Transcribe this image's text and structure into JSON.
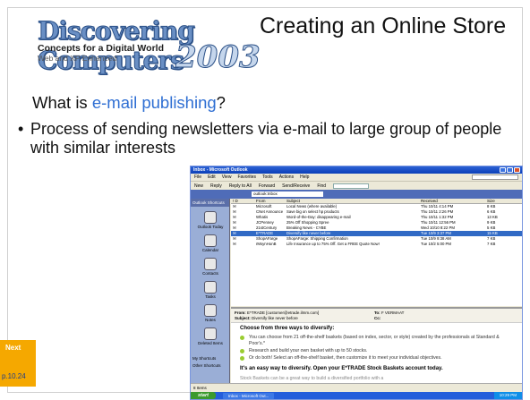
{
  "logo": {
    "brand": "Discovering Computers",
    "year": "2003",
    "tagline": "Concepts for a Digital World",
    "subtag": "Web and XP Enhanced"
  },
  "title": "Creating an Online Store",
  "question": {
    "prefix": "What is ",
    "link": "e-mail publishing",
    "suffix": "?"
  },
  "bullet": {
    "marker": "•",
    "text": "Process of sending newsletters via e-mail  to large group of people with similar interests"
  },
  "nav": {
    "next_label": "Next",
    "page_ref": "p.10.24"
  },
  "outlook": {
    "window_title": "Inbox - Microsoft Outlook",
    "menu": [
      "File",
      "Edit",
      "View",
      "Favorites",
      "Tools",
      "Actions",
      "Help"
    ],
    "toolbar": [
      "New",
      "Reply",
      "Reply to All",
      "Forward",
      "Send/Receive",
      "Find"
    ],
    "address": "outlook:Inbox",
    "sidebar": {
      "header": "Outlook Shortcuts",
      "items": [
        "Outlook Today",
        "Calendar",
        "Contacts",
        "Tasks",
        "Notes",
        "Deleted Items"
      ],
      "footer1": "My Shortcuts",
      "footer2": "Other Shortcuts"
    },
    "list_headers": [
      "! D",
      "From",
      "Subject",
      "Received",
      "Size"
    ],
    "rows": [
      {
        "from": "Microsoft",
        "subject": "Local News (where available)",
        "received": "Thu 10/11 4:14 PM",
        "size": "8 KB"
      },
      {
        "from": "CNet Announce",
        "subject": "Save big on select hp products",
        "received": "Thu 10/11 2:26 PM",
        "size": "6 KB"
      },
      {
        "from": "Whatis",
        "subject": "Word-of-the-Day: disappearing e-mail",
        "received": "Thu 10/11 1:32 PM",
        "size": "13 KB"
      },
      {
        "from": "JCPenney",
        "subject": "25% Off Shopping Spree",
        "received": "Thu 10/11 12:56 PM",
        "size": "9 KB"
      },
      {
        "from": "21stCentury",
        "subject": "Breaking News - CYBE",
        "received": "Wed 10/10 8:22 PM",
        "size": "5 KB"
      },
      {
        "from": "E*TRADE",
        "subject": "Diversify like never before",
        "received": "Tue 10/9 3:37 PM",
        "size": "15 KB",
        "selected": true
      },
      {
        "from": "ShopAFarge",
        "subject": "ShopAFarge: Shipping Confirmation",
        "received": "Tue 10/9 9:38 AM",
        "size": "7 KB"
      },
      {
        "from": "rMsynHonB",
        "subject": "Life Insurance up to 75% Off. Get a FREE Quote Now!",
        "received": "Tue 10/2 5:00 PM",
        "size": "7 KB"
      }
    ],
    "preview": {
      "from_label": "From:",
      "from_value": "E*TRADE [customer@etrade.ilmm.com]",
      "subject_label": "Subject:",
      "subject_value": "Diversify like never before",
      "to_label": "To:",
      "to_value": "F VERMAAT",
      "cc_label": "Cc:",
      "heading": "Choose from three ways to diversify:",
      "items": [
        "You can choose from 21 off-the-shelf baskets (based on index, sector, or style) created by the professionals at Standard & Poor's.*",
        "Research and build your own basket with up to 50 stocks.",
        "Or do both! Select an off-the-shelf basket, then customize it to meet your individual objectives."
      ],
      "tagline": "It's an easy way to diversify. Open your E*TRADE Stock Baskets account today.",
      "tail": "Stock Baskets can be a great way to build a diversified portfolio with a"
    },
    "status": "8 Items",
    "taskbar": {
      "start": "start",
      "task": "Inbox - Microsoft Out...",
      "clock": "10:29 PM"
    }
  }
}
